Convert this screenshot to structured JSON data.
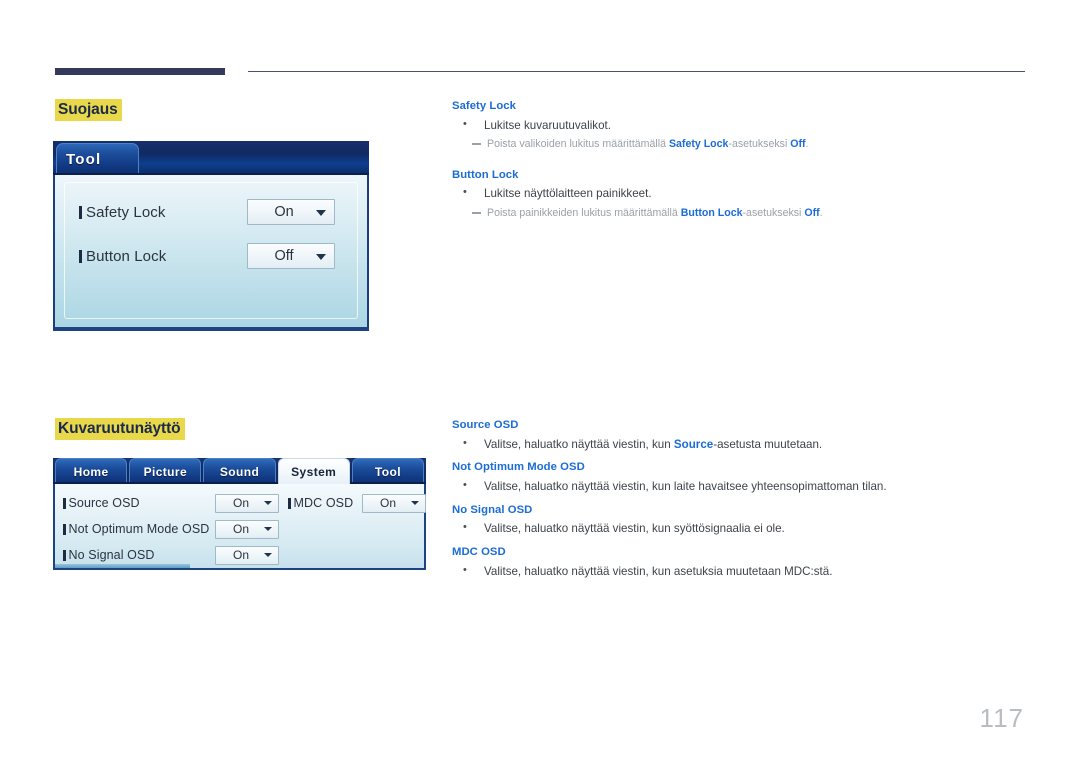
{
  "page": {
    "number": "117"
  },
  "sections": [
    {
      "heading": "Suojaus",
      "osd": {
        "type": "single-tab",
        "tab_label": "Tool",
        "rows": [
          {
            "label": "Safety Lock",
            "value": "On"
          },
          {
            "label": "Button Lock",
            "value": "Off"
          }
        ]
      },
      "text_blocks": [
        {
          "term": "Safety Lock",
          "bullet": "Lukitse kuvaruutuvalikot.",
          "note_pre": "Poista valikoiden lukitus määrittämällä ",
          "note_b1": "Safety Lock",
          "note_mid": "-asetukseksi ",
          "note_b2": "Off",
          "note_post": "."
        },
        {
          "term": "Button Lock",
          "bullet": "Lukitse näyttölaitteen painikkeet.",
          "note_pre": "Poista painikkeiden lukitus määrittämällä ",
          "note_b1": "Button Lock",
          "note_mid": "-asetukseksi ",
          "note_b2": "Off",
          "note_post": "."
        }
      ]
    },
    {
      "heading": "Kuvaruutunäyttö",
      "osd": {
        "type": "tabbed",
        "tabs": [
          {
            "label": "Home",
            "active": false
          },
          {
            "label": "Picture",
            "active": false
          },
          {
            "label": "Sound",
            "active": false
          },
          {
            "label": "System",
            "active": true
          },
          {
            "label": "Tool",
            "active": false
          }
        ],
        "rows_left": [
          {
            "label": "Source OSD",
            "value": "On"
          },
          {
            "label": "Not Optimum Mode OSD",
            "value": "On"
          },
          {
            "label": "No Signal OSD",
            "value": "On"
          }
        ],
        "rows_right": [
          {
            "label": "MDC OSD",
            "value": "On"
          }
        ]
      },
      "text_blocks": [
        {
          "term": "Source OSD",
          "bullet_pre": "Valitse, haluatko näyttää viestin, kun ",
          "bullet_b1": "Source",
          "bullet_post": "-asetusta muutetaan."
        },
        {
          "term": "Not Optimum Mode OSD",
          "bullet": "Valitse, haluatko näyttää viestin, kun laite havaitsee yhteensopimattoman tilan."
        },
        {
          "term": "No Signal OSD",
          "bullet": "Valitse, haluatko näyttää viestin, kun syöttösignaalia ei ole."
        },
        {
          "term": "MDC OSD",
          "bullet": "Valitse, haluatko näyttää viestin, kun asetuksia muutetaan MDC:stä."
        }
      ]
    }
  ]
}
